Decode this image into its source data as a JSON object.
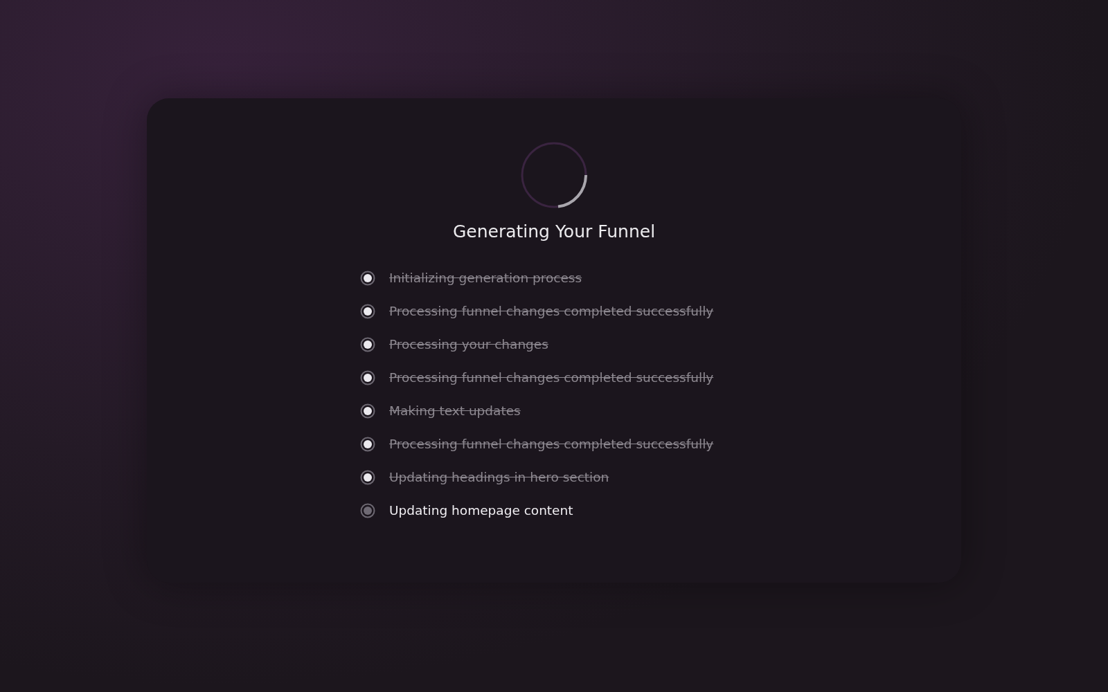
{
  "title": "Generating Your Funnel",
  "steps": [
    {
      "label": "Initializing generation process",
      "done": true
    },
    {
      "label": "Processing funnel changes completed successfully",
      "done": true
    },
    {
      "label": "Processing your changes",
      "done": true
    },
    {
      "label": "Processing funnel changes completed successfully",
      "done": true
    },
    {
      "label": "Making text updates",
      "done": true
    },
    {
      "label": "Processing funnel changes completed successfully",
      "done": true
    },
    {
      "label": "Updating headings in hero section",
      "done": true
    },
    {
      "label": "Updating homepage content",
      "done": false
    }
  ]
}
